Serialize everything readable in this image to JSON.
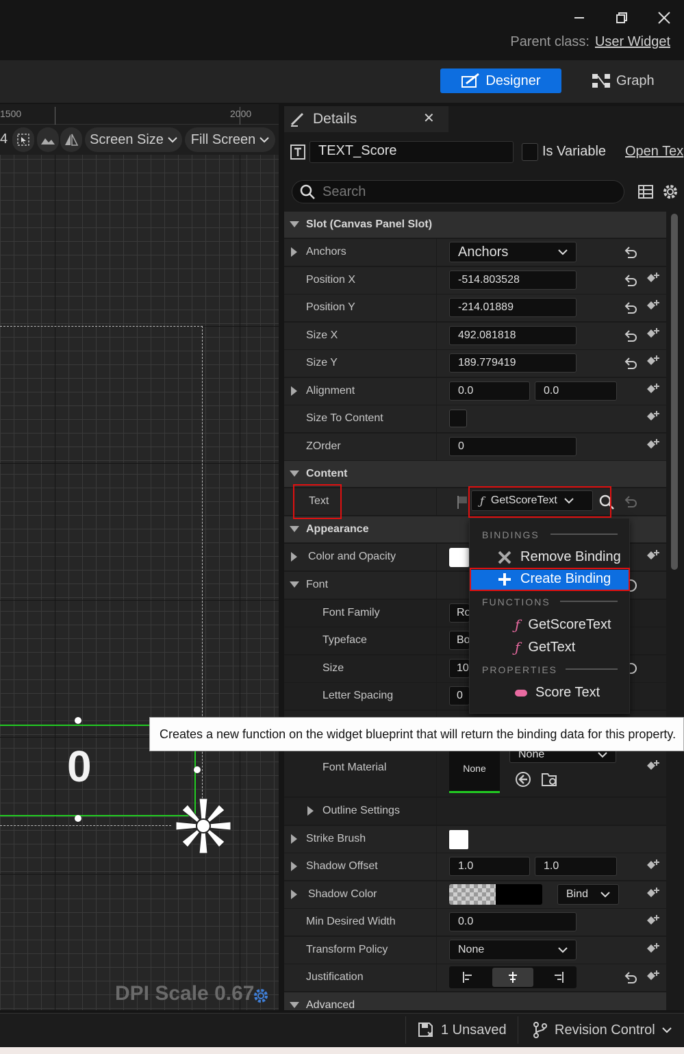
{
  "header": {
    "parent_class_label": "Parent class:",
    "parent_class_value": "User Widget"
  },
  "modes": {
    "designer": "Designer",
    "graph": "Graph"
  },
  "viewport": {
    "ruler": [
      "1500",
      "2000"
    ],
    "zoom_fragment": "4",
    "screen_size": "Screen Size",
    "fill_screen": "Fill Screen",
    "widget_text": "0",
    "dpi_scale": "DPI Scale 0.67"
  },
  "details": {
    "tab_title": "Details",
    "close_glyph": "✕",
    "widget_name": "TEXT_Score",
    "is_variable_label": "Is Variable",
    "open_text": "Open Tex",
    "search_placeholder": "Search",
    "sections": {
      "slot": "Slot (Canvas Panel Slot)",
      "content": "Content",
      "appearance": "Appearance",
      "advanced": "Advanced"
    },
    "slot": {
      "anchors_label": "Anchors",
      "anchors_value": "Anchors",
      "position_x_label": "Position X",
      "position_x": "-514.803528",
      "position_y_label": "Position Y",
      "position_y": "-214.01889",
      "size_x_label": "Size X",
      "size_x": "492.081818",
      "size_y_label": "Size Y",
      "size_y": "189.779419",
      "alignment_label": "Alignment",
      "alignment_x": "0.0",
      "alignment_y": "0.0",
      "size_to_content_label": "Size To Content",
      "zorder_label": "ZOrder",
      "zorder": "0"
    },
    "content": {
      "text_label": "Text",
      "binding_value": "GetScoreText"
    },
    "appearance": {
      "color_opacity": "Color and Opacity",
      "font": "Font",
      "font_family": "Font Family",
      "font_family_value": "Ro",
      "typeface": "Typeface",
      "typeface_value": "Bo",
      "size": "Size",
      "size_value": "10",
      "letter_spacing": "Letter Spacing",
      "letter_spacing_value": "0",
      "font_material": "Font Material",
      "font_material_value": "None",
      "font_material_combo": "None",
      "outline_settings": "Outline Settings",
      "strike_brush": "Strike Brush",
      "shadow_offset": "Shadow Offset",
      "shadow_offset_x": "1.0",
      "shadow_offset_y": "1.0",
      "shadow_color": "Shadow Color",
      "bind_label": "Bind",
      "min_desired_width": "Min Desired Width",
      "min_desired_width_value": "0.0",
      "transform_policy": "Transform Policy",
      "transform_policy_value": "None",
      "justification": "Justification"
    }
  },
  "dropdown": {
    "bindings_header": "BINDINGS",
    "remove_binding": "Remove Binding",
    "create_binding": "Create Binding",
    "functions_header": "FUNCTIONS",
    "functions": [
      "GetScoreText",
      "GetText"
    ],
    "properties_header": "PROPERTIES",
    "properties": [
      "Score Text"
    ]
  },
  "tooltip": "Creates a new function on the widget blueprint that will return the binding data for this property.",
  "statusbar": {
    "unsaved": "1 Unsaved",
    "revision_control": "Revision Control"
  },
  "colors": {
    "accent": "#0d6ee0",
    "highlight": "#e01010",
    "binding_pink": "#e86aa0",
    "selection_green": "#22cc22"
  }
}
